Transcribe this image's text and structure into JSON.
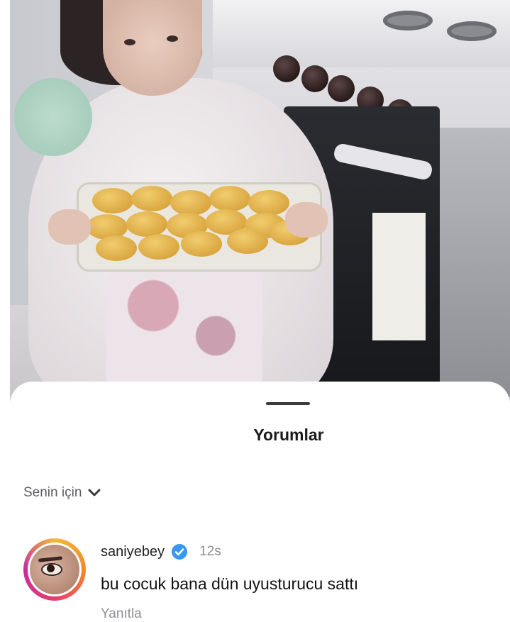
{
  "comments_panel": {
    "title": "Yorumlar",
    "filter": {
      "label": "Senin için",
      "icon": "chevron-down-icon"
    }
  },
  "comments": [
    {
      "username": "saniyebey",
      "verified": true,
      "verified_icon": "verified-badge-icon",
      "time": "12s",
      "text": "bu cocuk bana dün uyusturucu sattı",
      "reply_label": "Yanıtla"
    }
  ],
  "colors": {
    "verified_blue": "#3897f0",
    "secondary_text": "#8e8e93",
    "primary_text": "#141416",
    "story_ring": [
      "#f3b93a",
      "#f08a2b",
      "#e53e6f",
      "#c52e9c"
    ]
  }
}
